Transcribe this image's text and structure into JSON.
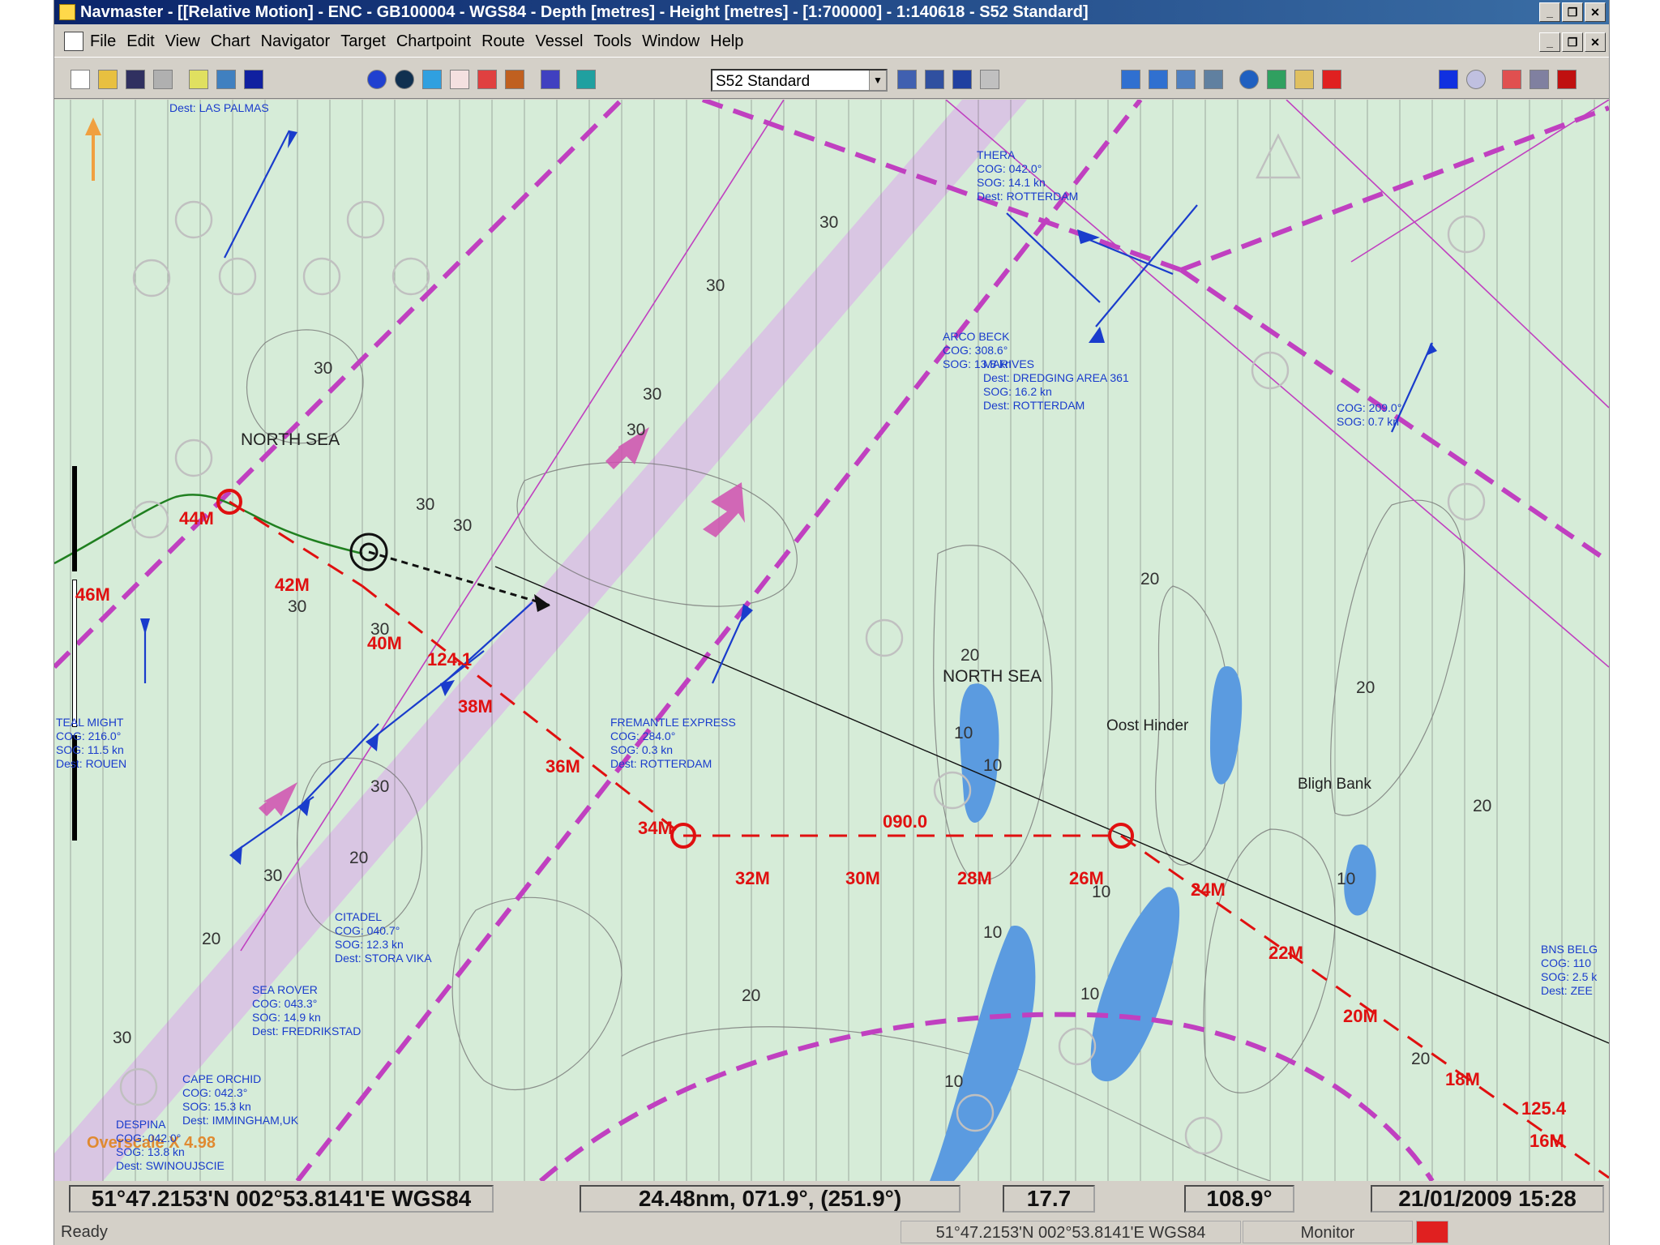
{
  "window": {
    "title": "Navmaster - [[Relative Motion] - ENC - GB100004 - WGS84 - Depth [metres] - Height [metres] - [1:700000] - 1:140618 - S52 Standard]"
  },
  "menu": [
    "File",
    "Edit",
    "View",
    "Chart",
    "Navigator",
    "Target",
    "Chartpoint",
    "Route",
    "Vessel",
    "Tools",
    "Window",
    "Help"
  ],
  "toolbar": {
    "display_mode": "S52 Standard"
  },
  "map": {
    "area_labels": [
      "NORTH SEA",
      "NORTH SEA",
      "Oost Hinder",
      "Bligh Bank"
    ],
    "depth_labels": [
      "30",
      "30",
      "30",
      "30",
      "30",
      "30",
      "30",
      "30",
      "30",
      "30",
      "30",
      "30",
      "20",
      "20",
      "20",
      "20",
      "20",
      "20",
      "20",
      "20",
      "10",
      "10",
      "10",
      "10",
      "10",
      "10",
      "10"
    ],
    "range_labels": [
      "44M",
      "46M",
      "42M",
      "40M",
      "38M",
      "36M",
      "34M",
      "32M",
      "30M",
      "28M",
      "26M",
      "24M",
      "22M",
      "20M",
      "18M",
      "16M"
    ],
    "route_labels": [
      "124.1",
      "090.0",
      "125.4"
    ],
    "overscale_label": "Overscale X 4.98",
    "vessels": [
      {
        "lines": [
          "Dest: LAS PALMAS"
        ]
      },
      {
        "lines": [
          "THERA",
          "COG: 042.0°",
          "SOG: 14.1 kn",
          "Dest: ROTTERDAM"
        ]
      },
      {
        "lines": [
          "ARCO BECK",
          "COG: 308.6°",
          "SOG: 13.8 kn"
        ]
      },
      {
        "lines": [
          "MARIVES",
          "Dest: DREDGING AREA 361",
          "SOG: 16.2 kn",
          "Dest: ROTTERDAM"
        ]
      },
      {
        "lines": [
          "COG: 209.0°",
          "SOG: 0.7 kn"
        ]
      },
      {
        "lines": [
          "TEAL MIGHT",
          "COG: 216.0°",
          "SOG: 11.5 kn",
          "Dest: ROUEN"
        ]
      },
      {
        "lines": [
          "FREMANTLE EXPRESS",
          "COG: 284.0°",
          "SOG: 0.3 kn",
          "Dest: ROTTERDAM"
        ]
      },
      {
        "lines": [
          "CITADEL",
          "COG: 040.7°",
          "SOG: 12.3 kn",
          "Dest: STORA VIKA"
        ]
      },
      {
        "lines": [
          "SEA ROVER",
          "COG: 043.3°",
          "SOG: 14.9 kn",
          "Dest: FREDRIKSTAD"
        ]
      },
      {
        "lines": [
          "CAPE ORCHID",
          "COG: 042.3°",
          "SOG: 15.3 kn",
          "Dest: IMMINGHAM,UK"
        ]
      },
      {
        "lines": [
          "DESPINA",
          "COG: 042.0°",
          "SOG: 13.8 kn",
          "Dest: SWINOUJSCIE"
        ]
      },
      {
        "lines": [
          "BNS BELG",
          "COG: 110",
          "SOG: 2.5 k",
          "Dest: ZEE"
        ]
      }
    ],
    "colors": {
      "sea": "#d6ecd8",
      "shallow": "#5b9be0",
      "traffic_lane": "#d9c6e3",
      "route_red": "#e01010",
      "boundary_magenta": "#c040c0",
      "vessel_blue": "#1a3ccc"
    }
  },
  "status": {
    "position": "51°47.2153'N 002°53.8141'E WGS84",
    "range_bearing": "24.48nm, 071.9°, (251.9°)",
    "speed": "17.7",
    "heading": "108.9°",
    "datetime": "21/01/2009 15:28"
  },
  "bottom": {
    "state": "Ready",
    "position": "51°47.2153'N 002°53.8141'E WGS84",
    "mode": "Monitor"
  }
}
